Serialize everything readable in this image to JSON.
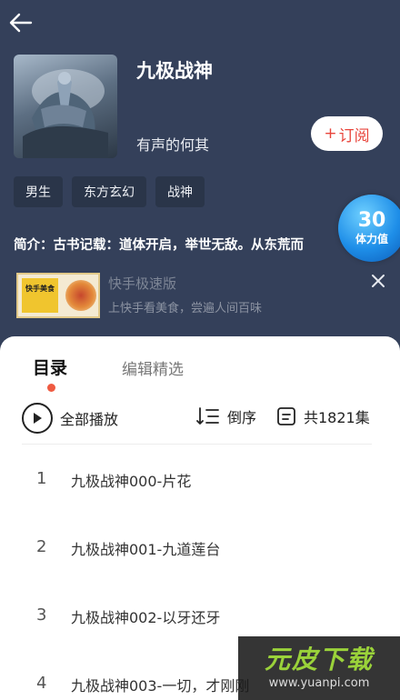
{
  "book": {
    "title": "九极战神",
    "author": "有声的何其",
    "subscribe_label": "订阅",
    "tags": [
      "男生",
      "东方玄幻",
      "战神"
    ],
    "intro": "简介：古书记载：道体开启，举世无敌。从东荒而"
  },
  "stamina": {
    "value": "30",
    "label": "体力值"
  },
  "ad": {
    "thumb_text": "快手美食",
    "title": "快手极速版",
    "desc": "上快手看美食，尝遍人间百味"
  },
  "tabs": {
    "catalog": "目录",
    "editor": "编辑精选"
  },
  "toolbar": {
    "play_all": "全部播放",
    "sort": "倒序",
    "count": "共1821集"
  },
  "chapters": [
    {
      "num": "1",
      "title": "九极战神000-片花"
    },
    {
      "num": "2",
      "title": "九极战神001-九道莲台"
    },
    {
      "num": "3",
      "title": "九极战神002-以牙还牙"
    },
    {
      "num": "4",
      "title": "九极战神003-一切，才刚刚"
    }
  ],
  "watermark": {
    "logo": "元皮下载",
    "url": "www.yuanpi.com"
  },
  "colors": {
    "header_bg": "#34405a",
    "accent_red": "#e8453c",
    "dot": "#ef5a41"
  }
}
